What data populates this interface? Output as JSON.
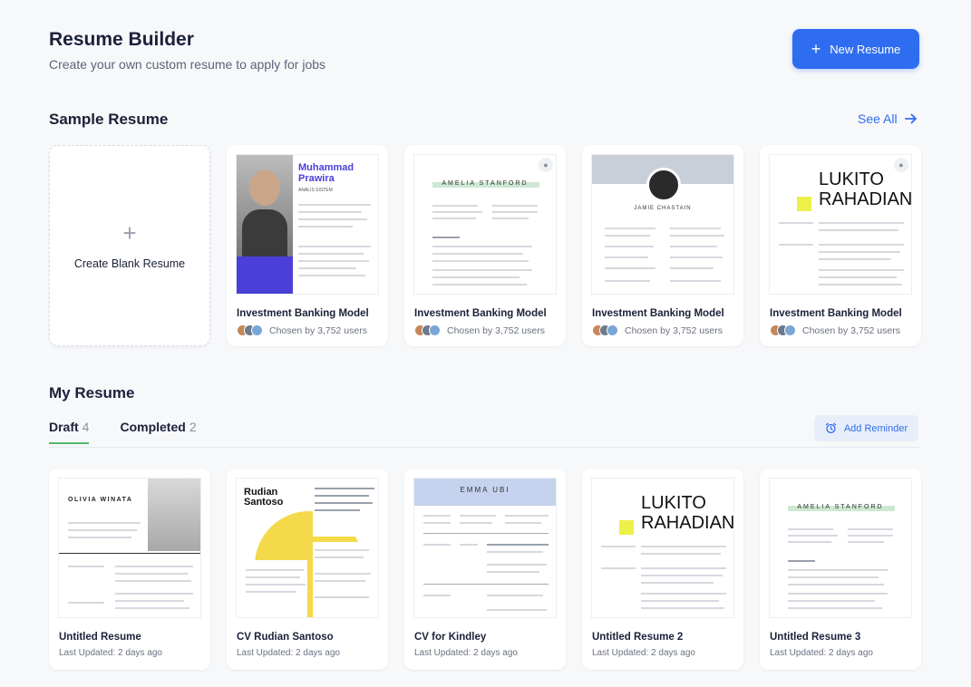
{
  "header": {
    "title": "Resume Builder",
    "subtitle": "Create your own custom resume to apply for jobs",
    "new_button": "New Resume",
    "new_button_icon": "plus-icon"
  },
  "sample": {
    "title": "Sample Resume",
    "see_all": "See All",
    "create_blank": "Create Blank Resume",
    "templates": [
      {
        "title": "Investment Banking Model",
        "meta": "Chosen by 3,752 users",
        "preview_name": "Muhammad Prawira",
        "preview_role": "ANALIS SISTEM",
        "locked": false
      },
      {
        "title": "Investment Banking Model",
        "meta": "Chosen by 3,752 users",
        "preview_name": "AMELIA STANFORD",
        "locked": true
      },
      {
        "title": "Investment Banking Model",
        "meta": "Chosen by 3,752 users",
        "preview_name": "JAMIE CHASTAIN",
        "locked": false
      },
      {
        "title": "Investment Banking Model",
        "meta": "Chosen by 3,752 users",
        "preview_name": "LUKITO RAHADIAN",
        "locked": true
      }
    ]
  },
  "my_resume": {
    "title": "My Resume",
    "tabs": [
      {
        "label": "Draft",
        "count": "4"
      },
      {
        "label": "Completed",
        "count": "2"
      }
    ],
    "reminder_button": "Add Reminder",
    "reminder_icon": "alarm-clock-icon",
    "items": [
      {
        "title": "Untitled Resume",
        "updated": "Last Updated: 2 days ago",
        "preview_name": "OLIVIA WINATA"
      },
      {
        "title": "CV Rudian Santoso",
        "updated": "Last Updated: 2 days ago",
        "preview_name": "Rudian Santoso"
      },
      {
        "title": "CV for Kindley",
        "updated": "Last Updated: 2 days ago",
        "preview_name": "EMMA UBI"
      },
      {
        "title": "Untitled Resume 2",
        "updated": "Last Updated: 2 days ago",
        "preview_name": "LUKITO RAHADIAN"
      },
      {
        "title": "Untitled Resume 3",
        "updated": "Last Updated: 2 days ago",
        "preview_name": "AMELIA STANFORD"
      }
    ]
  },
  "colors": {
    "accent": "#2f6df0",
    "active_tab": "#55b96a",
    "purple": "#4a3fd8",
    "yellow": "#f4d94a"
  }
}
